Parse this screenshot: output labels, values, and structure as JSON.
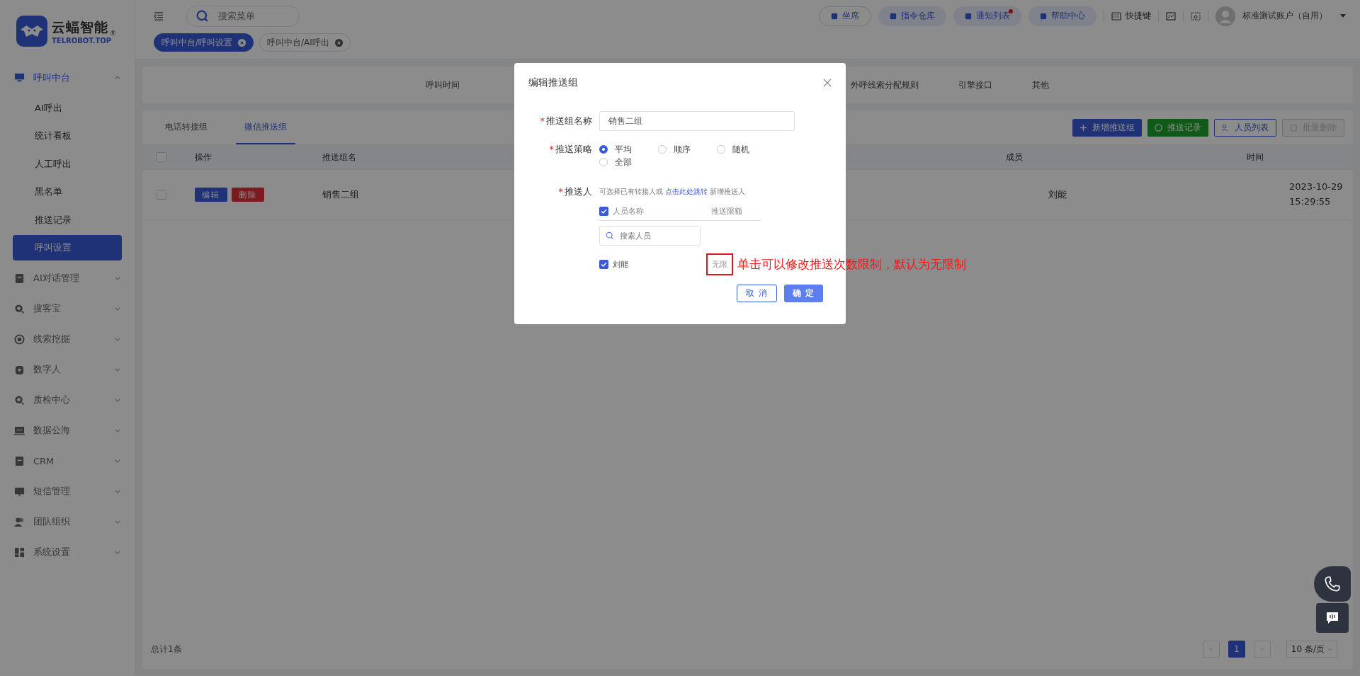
{
  "logo": {
    "name": "云蝠智能",
    "domain": "TELROBOT.TOP",
    "mark": "®"
  },
  "search": {
    "placeholder": "搜索菜单"
  },
  "header_buttons": [
    {
      "label": "坐席",
      "kind": "outline",
      "badge": false
    },
    {
      "label": "指令仓库",
      "kind": "filled",
      "badge": false
    },
    {
      "label": "通知列表",
      "kind": "filled",
      "badge": true
    },
    {
      "label": "帮助中心",
      "kind": "filled",
      "badge": false
    }
  ],
  "shortcut": {
    "label": "快捷键"
  },
  "user": {
    "name": "标准测试账户（自用）"
  },
  "page_tags": [
    {
      "label": "呼叫中台/呼叫设置",
      "selected": true
    },
    {
      "label": "呼叫中台/AI呼出",
      "selected": false
    }
  ],
  "sidebar": {
    "items": [
      {
        "label": "呼叫中台",
        "expanded": true,
        "children": [
          {
            "label": "AI呼出",
            "selected": false
          },
          {
            "label": "统计看板",
            "selected": false
          },
          {
            "label": "人工呼出",
            "selected": false
          },
          {
            "label": "黑名单",
            "selected": false
          },
          {
            "label": "推送记录",
            "selected": false
          },
          {
            "label": "呼叫设置",
            "selected": true
          }
        ]
      },
      {
        "label": "AI对话管理",
        "expanded": false
      },
      {
        "label": "搜客宝",
        "expanded": false
      },
      {
        "label": "线索挖掘",
        "expanded": false
      },
      {
        "label": "数字人",
        "expanded": false
      },
      {
        "label": "质检中心",
        "expanded": false
      },
      {
        "label": "数据公海",
        "expanded": false
      },
      {
        "label": "CRM",
        "expanded": false
      },
      {
        "label": "短信管理",
        "expanded": false
      },
      {
        "label": "团队组织",
        "expanded": false
      },
      {
        "label": "系统设置",
        "expanded": false
      }
    ]
  },
  "settings_tabs": [
    {
      "label": "呼叫时间"
    },
    {
      "label": "外呼线索分配规则"
    },
    {
      "label": "引擎接口"
    },
    {
      "label": "其他"
    }
  ],
  "sub_tabs": [
    {
      "label": "电话转接组",
      "selected": false
    },
    {
      "label": "微信推送组",
      "selected": true
    }
  ],
  "actions": [
    {
      "label": "新增推送组",
      "kind": "primary"
    },
    {
      "label": "推送记录",
      "kind": "success"
    },
    {
      "label": "人员列表",
      "kind": "outline"
    },
    {
      "label": "批量删除",
      "kind": "disabled"
    }
  ],
  "table": {
    "all_checked": false,
    "columns": [
      "操作",
      "推送组名",
      "成员",
      "时间"
    ],
    "rows": [
      {
        "checked": false,
        "actions": [
          "编辑",
          "删除"
        ],
        "name": "销售二组",
        "members": "刘能",
        "time": "2023-10-29 15:29:55"
      }
    ]
  },
  "footer": {
    "total": "总计1条",
    "pages": [
      {
        "label": "1",
        "selected": true
      }
    ],
    "page_size": "10 条/页"
  },
  "dialog": {
    "title": "编辑推送组",
    "name_field": {
      "label": "推送组名称",
      "required_mark": "*",
      "value": "销售二组"
    },
    "strategy": {
      "label": "推送策略",
      "required_mark": "*",
      "options": [
        {
          "label": "平均",
          "selected": true
        },
        {
          "label": "顺序",
          "selected": false
        },
        {
          "label": "随机",
          "selected": false
        },
        {
          "label": "全部",
          "selected": false
        }
      ]
    },
    "pushers": {
      "label": "推送人",
      "required_mark": "*",
      "hint_before": "可选择已有转接人或",
      "hint_link": "点击此处跳转",
      "hint_after": "新增推送人",
      "all_checked": true,
      "columns": [
        "人员名称",
        "推送限额"
      ],
      "search_placeholder": "搜索人员",
      "people": [
        {
          "name": "刘能",
          "checked": true,
          "limit": "无限"
        }
      ]
    },
    "annotation": "单击可以修改推送次数限制，默认为无限制",
    "buttons": [
      {
        "label": "取 消",
        "kind": "cancel"
      },
      {
        "label": "确 定",
        "kind": "confirm"
      }
    ]
  }
}
